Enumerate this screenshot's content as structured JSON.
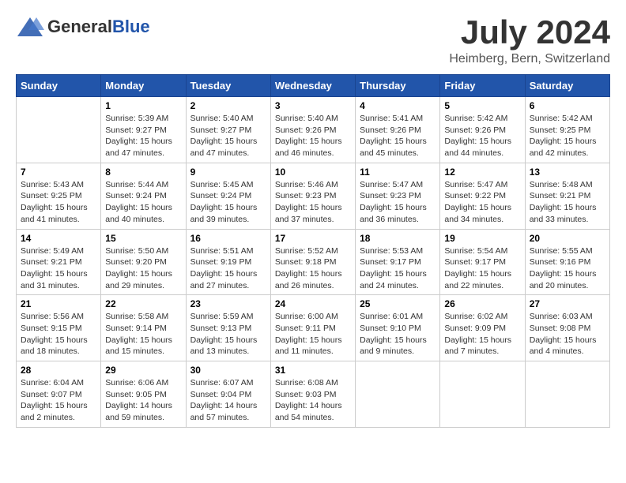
{
  "header": {
    "logo_general": "General",
    "logo_blue": "Blue",
    "month_title": "July 2024",
    "location": "Heimberg, Bern, Switzerland"
  },
  "weekdays": [
    "Sunday",
    "Monday",
    "Tuesday",
    "Wednesday",
    "Thursday",
    "Friday",
    "Saturday"
  ],
  "weeks": [
    [
      {
        "day": "",
        "info": ""
      },
      {
        "day": "1",
        "info": "Sunrise: 5:39 AM\nSunset: 9:27 PM\nDaylight: 15 hours\nand 47 minutes."
      },
      {
        "day": "2",
        "info": "Sunrise: 5:40 AM\nSunset: 9:27 PM\nDaylight: 15 hours\nand 47 minutes."
      },
      {
        "day": "3",
        "info": "Sunrise: 5:40 AM\nSunset: 9:26 PM\nDaylight: 15 hours\nand 46 minutes."
      },
      {
        "day": "4",
        "info": "Sunrise: 5:41 AM\nSunset: 9:26 PM\nDaylight: 15 hours\nand 45 minutes."
      },
      {
        "day": "5",
        "info": "Sunrise: 5:42 AM\nSunset: 9:26 PM\nDaylight: 15 hours\nand 44 minutes."
      },
      {
        "day": "6",
        "info": "Sunrise: 5:42 AM\nSunset: 9:25 PM\nDaylight: 15 hours\nand 42 minutes."
      }
    ],
    [
      {
        "day": "7",
        "info": "Sunrise: 5:43 AM\nSunset: 9:25 PM\nDaylight: 15 hours\nand 41 minutes."
      },
      {
        "day": "8",
        "info": "Sunrise: 5:44 AM\nSunset: 9:24 PM\nDaylight: 15 hours\nand 40 minutes."
      },
      {
        "day": "9",
        "info": "Sunrise: 5:45 AM\nSunset: 9:24 PM\nDaylight: 15 hours\nand 39 minutes."
      },
      {
        "day": "10",
        "info": "Sunrise: 5:46 AM\nSunset: 9:23 PM\nDaylight: 15 hours\nand 37 minutes."
      },
      {
        "day": "11",
        "info": "Sunrise: 5:47 AM\nSunset: 9:23 PM\nDaylight: 15 hours\nand 36 minutes."
      },
      {
        "day": "12",
        "info": "Sunrise: 5:47 AM\nSunset: 9:22 PM\nDaylight: 15 hours\nand 34 minutes."
      },
      {
        "day": "13",
        "info": "Sunrise: 5:48 AM\nSunset: 9:21 PM\nDaylight: 15 hours\nand 33 minutes."
      }
    ],
    [
      {
        "day": "14",
        "info": "Sunrise: 5:49 AM\nSunset: 9:21 PM\nDaylight: 15 hours\nand 31 minutes."
      },
      {
        "day": "15",
        "info": "Sunrise: 5:50 AM\nSunset: 9:20 PM\nDaylight: 15 hours\nand 29 minutes."
      },
      {
        "day": "16",
        "info": "Sunrise: 5:51 AM\nSunset: 9:19 PM\nDaylight: 15 hours\nand 27 minutes."
      },
      {
        "day": "17",
        "info": "Sunrise: 5:52 AM\nSunset: 9:18 PM\nDaylight: 15 hours\nand 26 minutes."
      },
      {
        "day": "18",
        "info": "Sunrise: 5:53 AM\nSunset: 9:17 PM\nDaylight: 15 hours\nand 24 minutes."
      },
      {
        "day": "19",
        "info": "Sunrise: 5:54 AM\nSunset: 9:17 PM\nDaylight: 15 hours\nand 22 minutes."
      },
      {
        "day": "20",
        "info": "Sunrise: 5:55 AM\nSunset: 9:16 PM\nDaylight: 15 hours\nand 20 minutes."
      }
    ],
    [
      {
        "day": "21",
        "info": "Sunrise: 5:56 AM\nSunset: 9:15 PM\nDaylight: 15 hours\nand 18 minutes."
      },
      {
        "day": "22",
        "info": "Sunrise: 5:58 AM\nSunset: 9:14 PM\nDaylight: 15 hours\nand 15 minutes."
      },
      {
        "day": "23",
        "info": "Sunrise: 5:59 AM\nSunset: 9:13 PM\nDaylight: 15 hours\nand 13 minutes."
      },
      {
        "day": "24",
        "info": "Sunrise: 6:00 AM\nSunset: 9:11 PM\nDaylight: 15 hours\nand 11 minutes."
      },
      {
        "day": "25",
        "info": "Sunrise: 6:01 AM\nSunset: 9:10 PM\nDaylight: 15 hours\nand 9 minutes."
      },
      {
        "day": "26",
        "info": "Sunrise: 6:02 AM\nSunset: 9:09 PM\nDaylight: 15 hours\nand 7 minutes."
      },
      {
        "day": "27",
        "info": "Sunrise: 6:03 AM\nSunset: 9:08 PM\nDaylight: 15 hours\nand 4 minutes."
      }
    ],
    [
      {
        "day": "28",
        "info": "Sunrise: 6:04 AM\nSunset: 9:07 PM\nDaylight: 15 hours\nand 2 minutes."
      },
      {
        "day": "29",
        "info": "Sunrise: 6:06 AM\nSunset: 9:05 PM\nDaylight: 14 hours\nand 59 minutes."
      },
      {
        "day": "30",
        "info": "Sunrise: 6:07 AM\nSunset: 9:04 PM\nDaylight: 14 hours\nand 57 minutes."
      },
      {
        "day": "31",
        "info": "Sunrise: 6:08 AM\nSunset: 9:03 PM\nDaylight: 14 hours\nand 54 minutes."
      },
      {
        "day": "",
        "info": ""
      },
      {
        "day": "",
        "info": ""
      },
      {
        "day": "",
        "info": ""
      }
    ]
  ]
}
